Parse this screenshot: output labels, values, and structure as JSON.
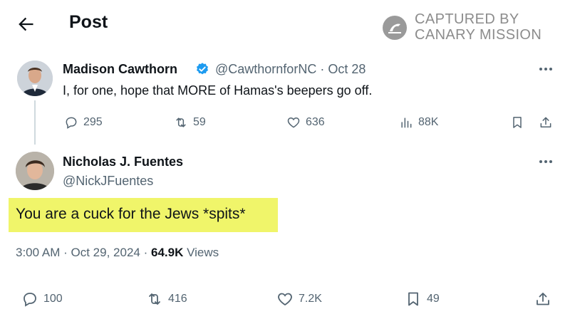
{
  "header": {
    "back_icon": "arrow-left-icon",
    "title": "Post"
  },
  "watermark": {
    "line1": "CAPTURED BY",
    "line2": "CANARY MISSION"
  },
  "parent_post": {
    "author_name": "Madison Cawthorn",
    "verified": true,
    "handle": "@CawthornforNC",
    "separator": "·",
    "date": "Oct 28",
    "text": "I, for one, hope that MORE of Hamas's beepers go off.",
    "replies": "295",
    "reposts": "59",
    "likes": "636",
    "views": "88K"
  },
  "main_post": {
    "author_name": "Nicholas J. Fuentes",
    "handle": "@NickJFuentes",
    "text": "You are a cuck for the Jews *spits*",
    "time": "3:00 AM",
    "separator": "·",
    "date": "Oct 29, 2024",
    "views_count": "64.9K",
    "views_label": "Views",
    "replies": "100",
    "reposts": "416",
    "likes": "7.2K",
    "bookmarks": "49"
  },
  "colors": {
    "text": "#0f1419",
    "secondary": "#536471",
    "verified": "#1d9bf0",
    "highlight": "#f0f56a"
  }
}
